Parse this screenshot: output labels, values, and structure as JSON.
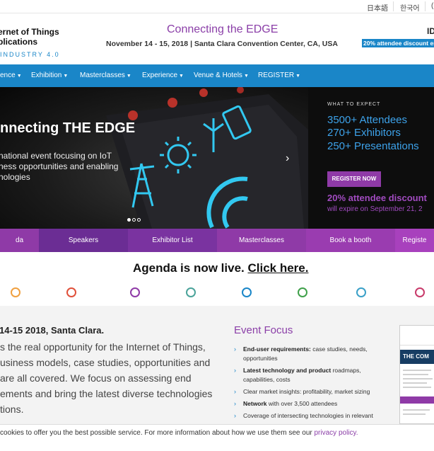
{
  "languages": [
    "日本語",
    "한국어",
    "("
  ],
  "header": {
    "logo_line1": "ernet of Things",
    "logo_line2": "plications",
    "logo_line3": "INDUSTRY 4.0",
    "tagline": "Connecting the EDGE",
    "dates": "November 14 - 15, 2018 | Santa Clara Convention Center, CA, USA",
    "idg": "ID",
    "discount_strip": "20% attendee discount en"
  },
  "nav": [
    {
      "label": "ence"
    },
    {
      "label": "Exhibition"
    },
    {
      "label": "Masterclasses"
    },
    {
      "label": "Experience"
    },
    {
      "label": "Venue & Hotels"
    },
    {
      "label": "REGISTER"
    }
  ],
  "hero": {
    "title": "nnecting THE EDGE",
    "desc_line1": "national event focusing on IoT",
    "desc_line2": "ness opportunities and enabling",
    "desc_line3": "nologies",
    "expect_label": "WHAT TO EXPECT",
    "stats": [
      "3500+ Attendees",
      "270+ Exhibitors",
      "250+ Presentations"
    ],
    "register_label": "REGISTER NOW",
    "discount": "20% attendee discount",
    "discount_expire": "will expire on September 21, 2"
  },
  "tabs": [
    {
      "label": "da",
      "color": "#8f3aa7"
    },
    {
      "label": "Speakers",
      "color": "#6b2d94"
    },
    {
      "label": "Exhibitor List",
      "color": "#7a33a0"
    },
    {
      "label": "Masterclasses",
      "color": "#8f3aa7"
    },
    {
      "label": "Book a booth",
      "color": "#9a3cb0"
    },
    {
      "label": "Registe",
      "color": "#a841bd"
    }
  ],
  "agenda": {
    "text": "Agenda is now live. ",
    "link": "Click here."
  },
  "timeline_colors": [
    "#f0a040",
    "#ec7a2a",
    "#e0503a",
    "#8f3aa7",
    "#4aa39a",
    "#1a86c8",
    "#3fa04a",
    "#3aa0c8",
    "#c83a6a"
  ],
  "intro": {
    "title": "14-15 2018, Santa Clara.",
    "body": "s the real opportunity for the Internet of Things, usiness models, case studies, opportunities and are all covered. We focus on assessing end ements and bring the latest diverse technologies tions."
  },
  "focus": {
    "title": "Event Focus",
    "items": [
      {
        "bold": "End-user requirements:",
        "rest": " case studies, needs, opportunities"
      },
      {
        "bold": "Latest technology and product",
        "rest": " roadmaps, capabilities, costs"
      },
      {
        "bold": "",
        "rest": "Clear market insights: profitability, market sizing"
      },
      {
        "bold": "Network",
        "rest": " with over 3,500 attendees"
      },
      {
        "bold": "",
        "rest": "Coverage of intersecting technologies in relevant"
      }
    ]
  },
  "brochure": {
    "band": "THE COM"
  },
  "cookie": {
    "text": " cookies to offer you the best possible service. For more information about how we use them see our ",
    "link": "privacy policy."
  }
}
